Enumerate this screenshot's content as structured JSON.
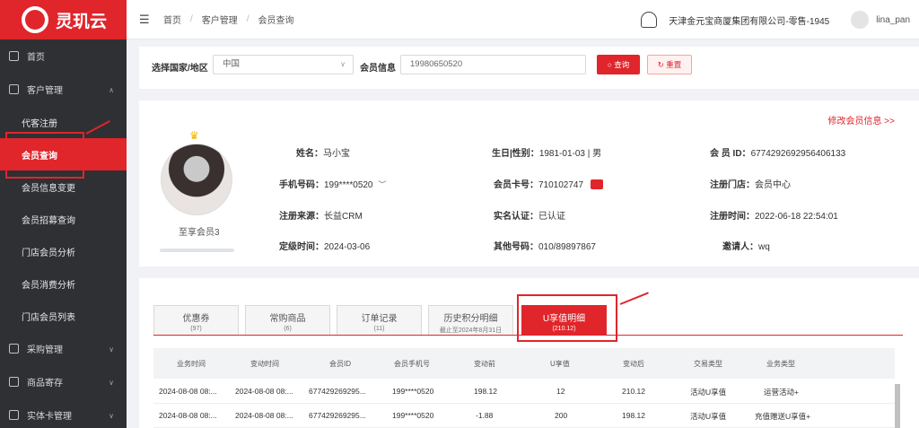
{
  "app": {
    "logo_text": "灵玑云",
    "brand_color": "#e0252b"
  },
  "sidebar": {
    "home": "首页",
    "customer_mgmt": "客户管理",
    "sub_items": [
      "代客注册",
      "会员查询",
      "会员信息变更",
      "会员招募查询",
      "门店会员分析",
      "会员消费分析",
      "门店会员列表"
    ],
    "active_sub": "会员查询",
    "bottom": [
      "采购管理",
      "商品寄存",
      "实体卡管理"
    ]
  },
  "header": {
    "breadcrumb": [
      "首页",
      "客户管理",
      "会员查询"
    ],
    "org": "天津金元宝商厦集团有限公司-零售-1945",
    "user": "lina_pan"
  },
  "search": {
    "region_label": "选择国家/地区",
    "region_value": "中国",
    "member_label": "会员信息",
    "member_value": "19980650520",
    "query_btn": "查询",
    "reset_btn": "重置"
  },
  "member": {
    "edit_link": "修改会员信息 >>",
    "level": "至享会员3",
    "fields": [
      {
        "label": "姓名：",
        "value": "马小宝"
      },
      {
        "label": "生日|性别：",
        "value": "1981-01-03 | 男"
      },
      {
        "label": "会 员 ID：",
        "value": "6774292692956406133"
      },
      {
        "label": "手机号码：",
        "value": "199****0520"
      },
      {
        "label": "会员卡号：",
        "value": "710102747"
      },
      {
        "label": "注册门店：",
        "value": "会员中心"
      },
      {
        "label": "注册来源：",
        "value": "长益CRM"
      },
      {
        "label": "实名认证：",
        "value": "已认证"
      },
      {
        "label": "注册时间：",
        "value": "2022-06-18 22:54:01"
      },
      {
        "label": "定级时间：",
        "value": "2024-03-06"
      },
      {
        "label": "其他号码：",
        "value": "010/89897867"
      },
      {
        "label": "邀请人：",
        "value": "wq"
      }
    ]
  },
  "tabs": [
    {
      "label": "优惠券",
      "sub": "(97)"
    },
    {
      "label": "常购商品",
      "sub": "(6)"
    },
    {
      "label": "订单记录",
      "sub": "(11)"
    },
    {
      "label": "历史积分明细",
      "sub": "截止至2024年8月31日"
    },
    {
      "label": "U享值明细",
      "sub": "(210.12)"
    }
  ],
  "table": {
    "headers": [
      "业务时间",
      "变动时间",
      "会员ID",
      "会员手机号",
      "变动前",
      "U享值",
      "变动后",
      "交易类型",
      "业务类型"
    ],
    "rows": [
      [
        "2024-08-08 08:...",
        "2024-08-08 08:...",
        "677429269295...",
        "199****0520",
        "198.12",
        "12",
        "210.12",
        "活动U享值",
        "运营活动+"
      ],
      [
        "2024-08-08 08:...",
        "2024-08-08 08:...",
        "677429269295...",
        "199****0520",
        "-1.88",
        "200",
        "198.12",
        "活动U享值",
        "充值赠送U享值+"
      ]
    ]
  }
}
